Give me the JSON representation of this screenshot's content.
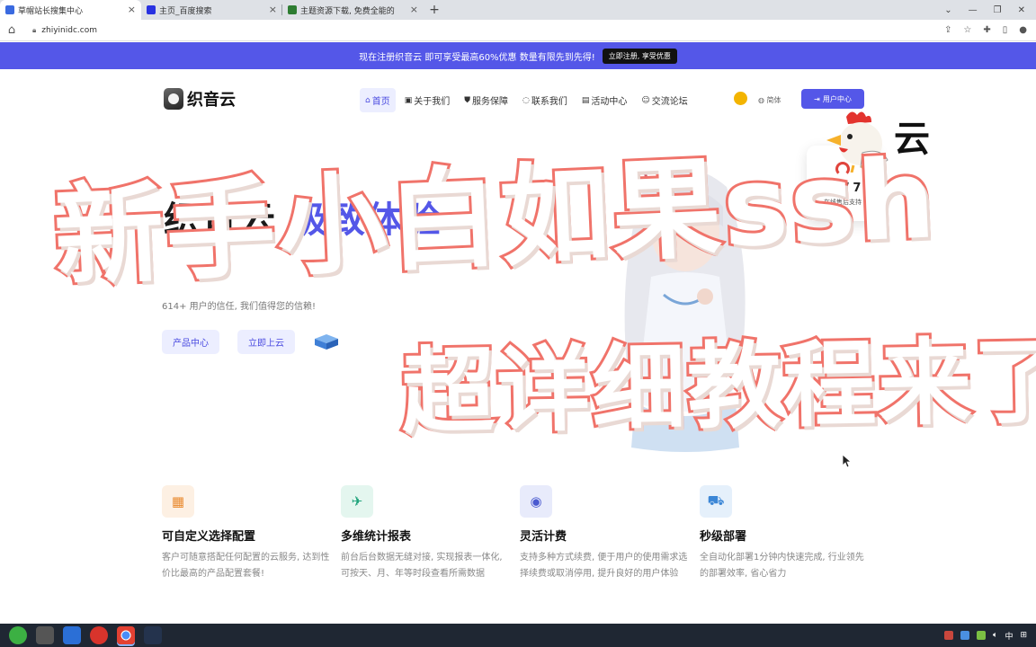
{
  "browser": {
    "tabs": [
      {
        "title": "草帽站长搜集中心",
        "active": true,
        "favicon_color": "#3a6ae0"
      },
      {
        "title": "主页_百度搜索",
        "active": false,
        "favicon_color": "#2932e1"
      },
      {
        "title": "主题资源下载, 免费全能的",
        "active": false,
        "favicon_color": "#2e7d32"
      }
    ],
    "new_tab_label": "+",
    "url": "zhiyinidc.com"
  },
  "promo": {
    "text": "现在注册织音云 即可享受最高60%优惠 数量有限先到先得!",
    "button": "立即注册, 享受优惠"
  },
  "nav": {
    "logo_text": "织音云",
    "items": [
      {
        "icon": "⌂",
        "label": "首页",
        "active": true
      },
      {
        "icon": "▣",
        "label": "关于我们",
        "active": false
      },
      {
        "icon": "⛊",
        "label": "服务保障",
        "active": false
      },
      {
        "icon": "◌",
        "label": "联系我们",
        "active": false
      },
      {
        "icon": "▤",
        "label": "活动中心",
        "active": false
      },
      {
        "icon": "☺",
        "label": "交流论坛",
        "active": false
      }
    ],
    "lang": "简体",
    "console_button": "用户中心"
  },
  "hero": {
    "title_part1": "织音云",
    "title_part2": "极致体验",
    "subtitle": "614+ 用户的信任, 我们值得您的信赖!",
    "button_products": "产品中心",
    "button_cloud": "立即上云"
  },
  "support_card": {
    "big": "24 / 7",
    "small": "在线售后支持"
  },
  "overlay": {
    "line1": "新手小白如果ssh",
    "line2": "超详细教程来了",
    "corner_char": "云"
  },
  "features": [
    {
      "icon": "▦",
      "icon_color": "#e98a2f",
      "icon_bg": "#fdf0e3",
      "title": "可自定义选择配置",
      "desc": "客户可随意搭配任何配置的云服务, 达到性价比最高的产品配置套餐!"
    },
    {
      "icon": "✈",
      "icon_color": "#1fa37b",
      "icon_bg": "#e4f6ef",
      "title": "多维统计报表",
      "desc": "前台后台数据无缝对接, 实现报表一体化, 可按天、月、年等时段查看所需数据"
    },
    {
      "icon": "◉",
      "icon_color": "#4a5ad0",
      "icon_bg": "#e8ebfb",
      "title": "灵活计费",
      "desc": "支持多种方式续费, 便于用户的使用需求选择续费或取消停用, 提升良好的用户体验"
    },
    {
      "icon": "⛟",
      "icon_color": "#3b86d6",
      "icon_bg": "#e5f0fb",
      "title": "秒级部署",
      "desc": "全自动化部署1分钟内快速完成, 行业领先的部署效率, 省心省力"
    }
  ],
  "taskbar": {
    "tray_lang": "中"
  },
  "colors": {
    "brand": "#5457e8",
    "overlay_stroke": "#f0736a"
  }
}
